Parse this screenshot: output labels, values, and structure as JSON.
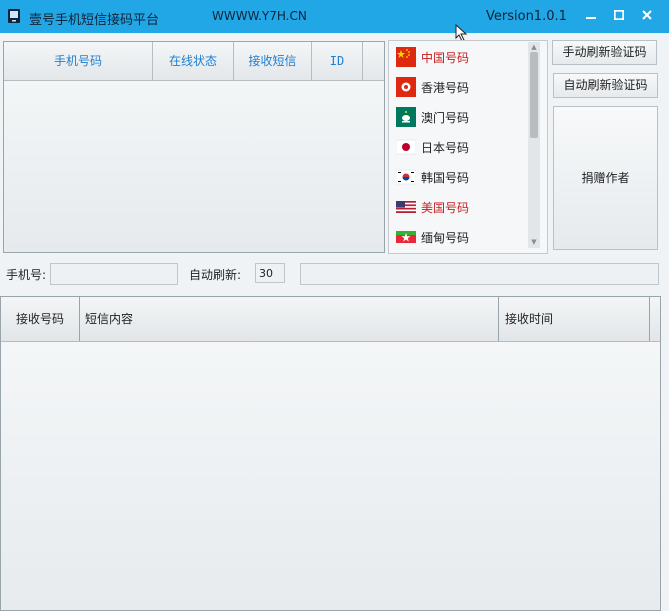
{
  "titlebar": {
    "title": "壹号手机短信接码平台",
    "url": "WWWW.Y7H.CN",
    "version": "Version1.0.1",
    "minimize_glyph": "▬",
    "maximize_glyph": "■",
    "close_glyph": "✕"
  },
  "phone_table": {
    "columns": [
      "手机号码",
      "在线状态",
      "接收短信",
      "ID"
    ]
  },
  "countries": [
    {
      "label": "中国号码",
      "flag": "china-flag",
      "color": "#c81e1e"
    },
    {
      "label": "香港号码",
      "flag": "hongkong-flag",
      "color": "#222222"
    },
    {
      "label": "澳门号码",
      "flag": "macau-flag",
      "color": "#222222"
    },
    {
      "label": "日本号码",
      "flag": "japan-flag",
      "color": "#222222"
    },
    {
      "label": "韩国号码",
      "flag": "korea-flag",
      "color": "#222222"
    },
    {
      "label": "美国号码",
      "flag": "usa-flag",
      "color": "#c81e1e"
    },
    {
      "label": "缅甸号码",
      "flag": "myanmar-flag",
      "color": "#222222"
    }
  ],
  "buttons": {
    "manual_refresh": "手动刷新验证码",
    "auto_refresh": "自动刷新验证码",
    "donate": "捐赠作者"
  },
  "form": {
    "phone_label": "手机号:",
    "phone_value": "",
    "auto_refresh_label": "自动刷新:",
    "auto_refresh_value": "30",
    "extra_value": ""
  },
  "sms_table": {
    "columns": [
      "接收号码",
      "短信内容",
      "接收时间"
    ]
  },
  "colors": {
    "titlebar": "#21a6e6",
    "header_text_blue": "#1e7fd0",
    "highlight_red": "#c81e1e"
  }
}
